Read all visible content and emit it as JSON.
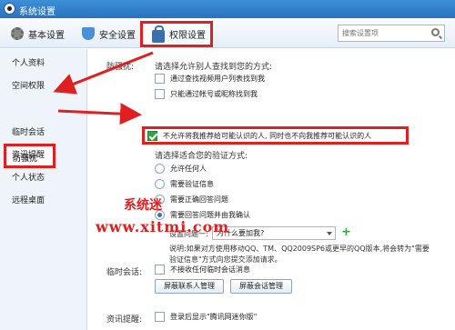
{
  "window": {
    "title": "系统设置"
  },
  "toolbar": {
    "tabs": [
      {
        "label": "基本设置",
        "icon": "gear-icon"
      },
      {
        "label": "安全设置",
        "icon": "shield-icon"
      },
      {
        "label": "权限设置",
        "icon": "lock-icon",
        "active": true
      }
    ],
    "search_placeholder": "搜索设置项"
  },
  "sidebar": {
    "items": [
      {
        "label": "个人资料"
      },
      {
        "label": "空间权限"
      },
      {
        "label": "防骚扰",
        "active": true
      },
      {
        "label": "临时会话"
      },
      {
        "label": "资讯提醒"
      },
      {
        "label": "个人状态"
      },
      {
        "label": "远程桌面"
      }
    ]
  },
  "anti_harass": {
    "section_label": "防骚扰:",
    "find_prompt": "请选择允许别人查找到您的方式:",
    "find_options": [
      {
        "label": "通过查找视频用户列表找到我",
        "checked": false
      },
      {
        "label": "只能通过帐号或昵称找到我",
        "checked": false
      },
      {
        "label": "不允许将我推荐给可能认识的人, 同时也不向我推荐可能认识的人",
        "checked": true
      }
    ],
    "verify_prompt": "请选择适合您的验证方式:",
    "verify_options": [
      {
        "label": "允许任何人",
        "selected": false
      },
      {
        "label": "需要验证信息",
        "selected": false
      },
      {
        "label": "需要正确回答问题",
        "selected": false
      },
      {
        "label": "需要回答问题并由我确认",
        "selected": true
      }
    ],
    "question_label": "设置问题一:",
    "question_value": "为什么要加我?",
    "note": "说明:如果对方使用移动QQ、TM、QQ2009SP6或更早的QQ版本,将会转为\"需要验证信息\"方式向您提交添加请求。"
  },
  "temp_session": {
    "section_label": "临时会话:",
    "option": {
      "label": "不接收任何临时会话消息",
      "checked": false
    },
    "buttons": [
      "屏蔽联系人管理",
      "屏蔽会话管理"
    ]
  },
  "news": {
    "section_label": "资讯提醒:",
    "option": {
      "label": "登录后显示\"腾讯网迷你版\"",
      "checked": false
    }
  },
  "watermark": {
    "cn": "系统迷",
    "url": "www.xitmi.com"
  },
  "colors": {
    "highlight": "#e02020",
    "titlebar": "#2a73be",
    "check": "#3aa048"
  }
}
